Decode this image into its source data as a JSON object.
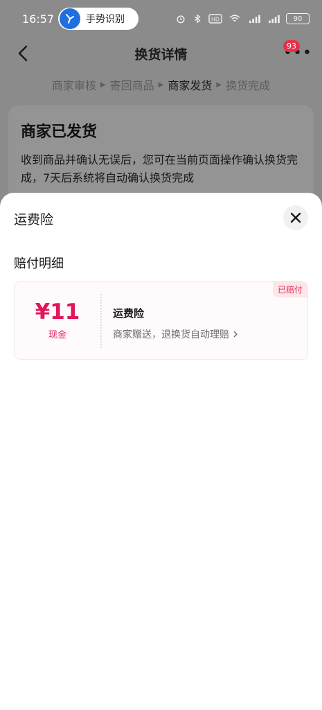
{
  "status_bar": {
    "time": "16:57",
    "gesture_label": "手势识别",
    "battery": "90",
    "icons": [
      "alarm-icon",
      "bluetooth-icon",
      "hd-icon",
      "wifi-icon",
      "signal-5g-icon",
      "signal-4g-icon",
      "battery-icon"
    ]
  },
  "nav": {
    "title": "换货详情",
    "badge_count": "93"
  },
  "steps": [
    {
      "label": "商家审核"
    },
    {
      "label": "寄回商品"
    },
    {
      "label": "商家发货"
    },
    {
      "label": "换货完成"
    }
  ],
  "status_card": {
    "title": "商家已发货",
    "desc": "收到商品并确认无误后，您可在当前页面操作确认换货完成，7天后系统将自动确认换货完成"
  },
  "sheet": {
    "title": "运费险",
    "section_title": "赔付明细",
    "card": {
      "tag": "已赔付",
      "amount": "¥11",
      "amount_sub": "现金",
      "name": "运费险",
      "desc": "商家赠送，退换货自动理赔"
    }
  },
  "colors": {
    "accent": "#e2165a",
    "badge": "#e5324b"
  }
}
